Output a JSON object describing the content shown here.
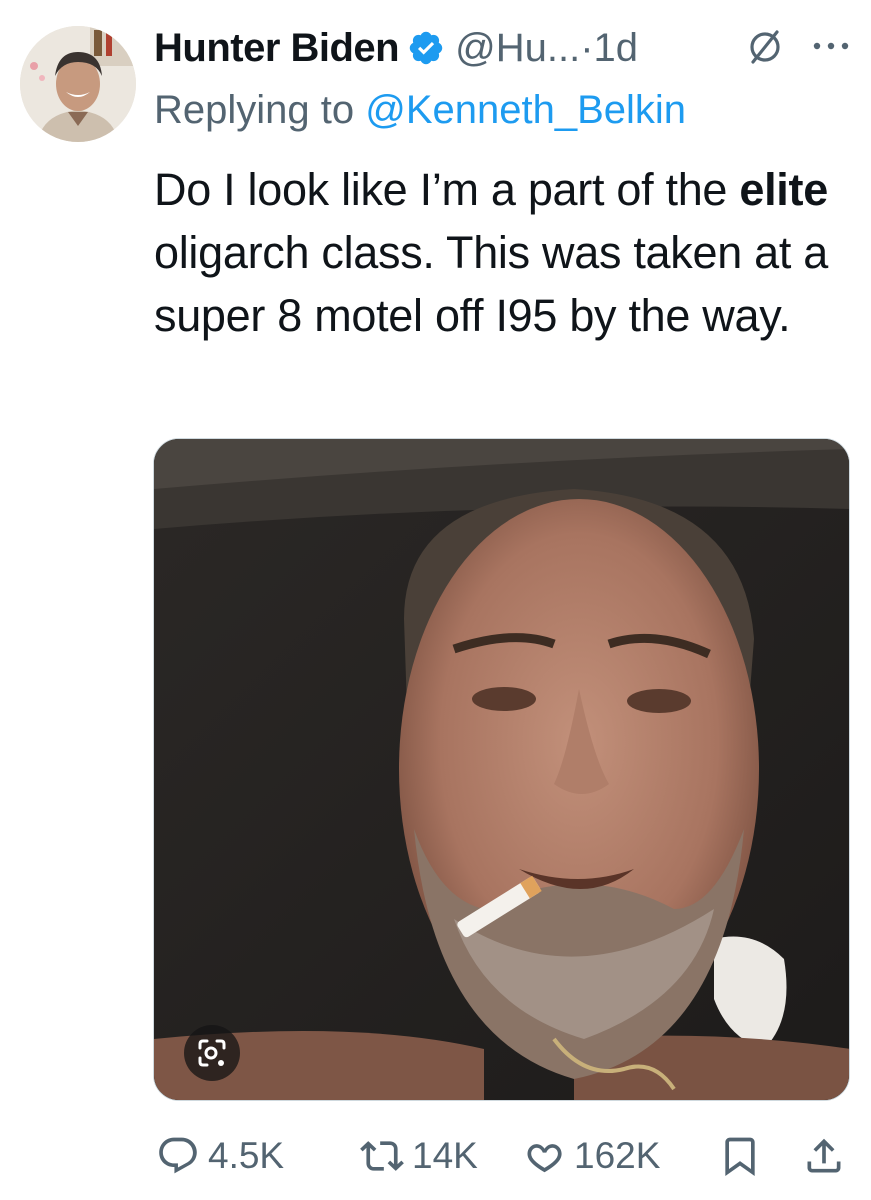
{
  "author": {
    "name": "Hunter Biden",
    "handle": "@Hu...",
    "separator": "·",
    "time": "1d",
    "avatar_icon": "avatar-photo",
    "verified_color": "#1d9bf0"
  },
  "reply": {
    "prefix": "Replying to ",
    "mention": "@Kenneth_Belkin"
  },
  "tweet": {
    "text_before": "Do I look like I’m a part of the ",
    "bold": "elite",
    "text_after": " oligarch class. This was taken at a super 8 motel off I95 by the way."
  },
  "media": {
    "description_icon": "photo",
    "lens_icon": "visual-search-icon"
  },
  "actions": {
    "replies": "4.5K",
    "reposts": "14K",
    "likes": "162K"
  },
  "colors": {
    "accent": "#1d9bf0",
    "muted": "#536471",
    "text": "#0f1419"
  }
}
